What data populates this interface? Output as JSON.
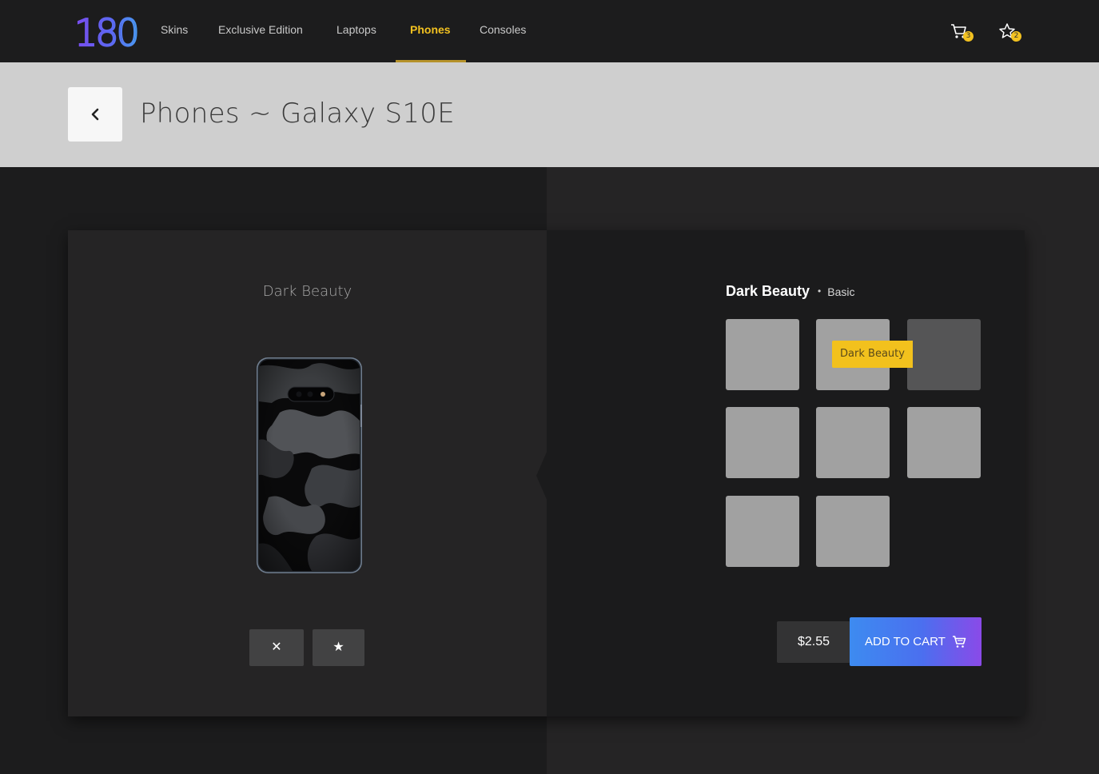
{
  "brand": {
    "logo_text": "180°"
  },
  "nav": {
    "items": [
      {
        "label": "Skins"
      },
      {
        "label": "Exclusive Edition"
      },
      {
        "label": "Laptops"
      },
      {
        "label": "Phones"
      },
      {
        "label": "Consoles"
      }
    ],
    "active_index": 3
  },
  "header_icons": {
    "cart": {
      "icon": "cart-icon",
      "count": "3"
    },
    "wishlist": {
      "icon": "star-icon",
      "count": "2"
    }
  },
  "page": {
    "back_icon": "chevron-left-icon",
    "title": "Phones ~ Galaxy S10E"
  },
  "preview": {
    "skin_name": "Dark Beauty",
    "device": "Galaxy S10E",
    "remove_icon": "close-icon",
    "remove_symbol": "✕",
    "favorite_icon": "star-filled-icon",
    "favorite_symbol": "★"
  },
  "selector": {
    "skin_name": "Dark Beauty",
    "tier": "Basic",
    "separator": "•",
    "swatch_count": 8,
    "selected_index": 2,
    "tooltip": "Dark Beauty"
  },
  "purchase": {
    "price": "$2.55",
    "add_to_cart_label": "ADD TO CART",
    "cart_icon": "cart-icon"
  },
  "colors": {
    "accent": "#f2c120",
    "background": "#1c1c1d",
    "header_band": "#cfcfcf",
    "panel_light": "#252425",
    "panel_dark": "#1b1b1c",
    "cta_gradient_start": "#3d8bf0",
    "cta_gradient_end": "#8a4ae8"
  }
}
